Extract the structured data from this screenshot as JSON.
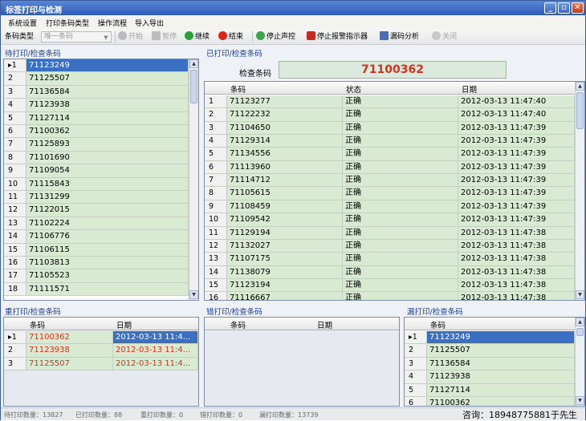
{
  "window": {
    "title": "标签打印与检测"
  },
  "menu": [
    "系统设置",
    "打印条码类型",
    "操作流程",
    "导入导出"
  ],
  "toolbar": {
    "type_label": "条码类型",
    "type_value": "唯一条码",
    "buttons": [
      {
        "label": "开始",
        "icon": "play-icon",
        "disabled": true
      },
      {
        "label": "暂停",
        "icon": "pause-icon",
        "disabled": true
      },
      {
        "label": "继续",
        "icon": "resume-icon",
        "disabled": false
      },
      {
        "label": "结束",
        "icon": "stop-icon",
        "disabled": false
      },
      {
        "label": "停止声控",
        "icon": "sound-icon",
        "disabled": false
      },
      {
        "label": "停止报警指示器",
        "icon": "alarm-icon",
        "disabled": false
      },
      {
        "label": "漏码分析",
        "icon": "chart-icon",
        "disabled": false
      },
      {
        "label": "关闭",
        "icon": "close-circle-icon",
        "disabled": true
      }
    ]
  },
  "pending": {
    "title": "待打印/检查条码",
    "rows": [
      "71123249",
      "71125507",
      "71136584",
      "71123938",
      "71127114",
      "71100362",
      "71125893",
      "71101690",
      "71109054",
      "71115843",
      "71131299",
      "71122015",
      "71102224",
      "71106776",
      "71106115",
      "71103813",
      "71105523",
      "71111571"
    ]
  },
  "printed": {
    "title": "已打印/检查条码",
    "check_label": "检查条码",
    "check_value": "71100362",
    "headers": [
      "条码",
      "状态",
      "日期"
    ],
    "rows": [
      [
        "71123277",
        "正确",
        "2012-03-13 11:47:40"
      ],
      [
        "71122232",
        "正确",
        "2012-03-13 11:47:40"
      ],
      [
        "71104650",
        "正确",
        "2012-03-13 11:47:39"
      ],
      [
        "71129314",
        "正确",
        "2012-03-13 11:47:39"
      ],
      [
        "71134556",
        "正确",
        "2012-03-13 11:47:39"
      ],
      [
        "71113960",
        "正确",
        "2012-03-13 11:47:39"
      ],
      [
        "71114712",
        "正确",
        "2012-03-13 11:47:39"
      ],
      [
        "71105615",
        "正确",
        "2012-03-13 11:47:39"
      ],
      [
        "71108459",
        "正确",
        "2012-03-13 11:47:39"
      ],
      [
        "71109542",
        "正确",
        "2012-03-13 11:47:39"
      ],
      [
        "71129194",
        "正确",
        "2012-03-13 11:47:38"
      ],
      [
        "71132027",
        "正确",
        "2012-03-13 11:47:38"
      ],
      [
        "71107175",
        "正确",
        "2012-03-13 11:47:38"
      ],
      [
        "71138079",
        "正确",
        "2012-03-13 11:47:38"
      ],
      [
        "71123194",
        "正确",
        "2012-03-13 11:47:38"
      ],
      [
        "71116667",
        "正确",
        "2012-03-13 11:47:38"
      ]
    ]
  },
  "reprint": {
    "title": "重打印/检查条码",
    "headers": [
      "条码",
      "日期"
    ],
    "rows": [
      [
        "71100362",
        "2012-03-13 11:4..."
      ],
      [
        "71123938",
        "2012-03-13 11:4..."
      ],
      [
        "71125507",
        "2012-03-13 11:4..."
      ]
    ]
  },
  "error": {
    "title": "错打印/检查条码",
    "headers": [
      "条码",
      "日期"
    ]
  },
  "missed": {
    "title": "漏打印/检查条码",
    "headers": [
      "条码"
    ],
    "rows": [
      "71123249",
      "71125507",
      "71136584",
      "71123938",
      "71127114",
      "71100362"
    ]
  },
  "status": {
    "pending_count": "待打印数量：13827",
    "printed_count": "已打印数量：88",
    "reprint_count": "重打印数量：0",
    "error_count": "错打印数量：0",
    "missed_count": "漏打印数量：13739"
  },
  "contact": "咨询：18948775881于先生",
  "colors": {
    "accent": "#3a6fc2",
    "row_bg": "#d9ead2",
    "check_value": "#d3321f"
  }
}
